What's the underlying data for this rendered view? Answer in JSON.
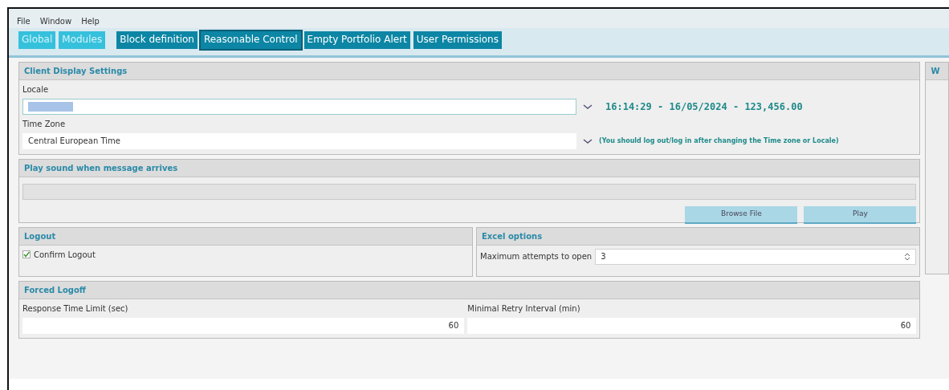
{
  "menu": [
    "File",
    "Window",
    "Help"
  ],
  "tabs": [
    {
      "label": "Global",
      "kind": "light",
      "selected": false
    },
    {
      "label": "Modules",
      "kind": "light",
      "selected": false
    },
    {
      "label": "Block definition",
      "kind": "dark",
      "selected": false
    },
    {
      "label": "Reasonable Control",
      "kind": "dark",
      "selected": true
    },
    {
      "label": "Empty Portfolio Alert",
      "kind": "dark",
      "selected": false
    },
    {
      "label": "User Permissions",
      "kind": "dark",
      "selected": false
    }
  ],
  "client_display": {
    "title": "Client Display Settings",
    "locale_label": "Locale",
    "locale_value_selected": true,
    "sample": "16:14:29 - 16/05/2024 - 123,456.00",
    "timezone_label": "Time Zone",
    "timezone_value": "Central European Time",
    "note": "(You should log out/log in after changing the Time zone or Locale)"
  },
  "sound": {
    "title": "Play sound when message arrives",
    "buttons": [
      "Browse File",
      "Play"
    ]
  },
  "logout": {
    "title": "Logout",
    "checkbox": {
      "label": "Confirm Logout",
      "checked": true
    }
  },
  "excel": {
    "title": "Excel options",
    "label": "Maximum attempts to open",
    "value": "3"
  },
  "forced_logoff": {
    "title": "Forced Logoff",
    "fields": [
      {
        "label": "Response Time Limit (sec)",
        "value": "60"
      },
      {
        "label": "Minimal Retry Interval (min)",
        "value": "60"
      }
    ]
  },
  "side_panel": {
    "title": "W"
  }
}
